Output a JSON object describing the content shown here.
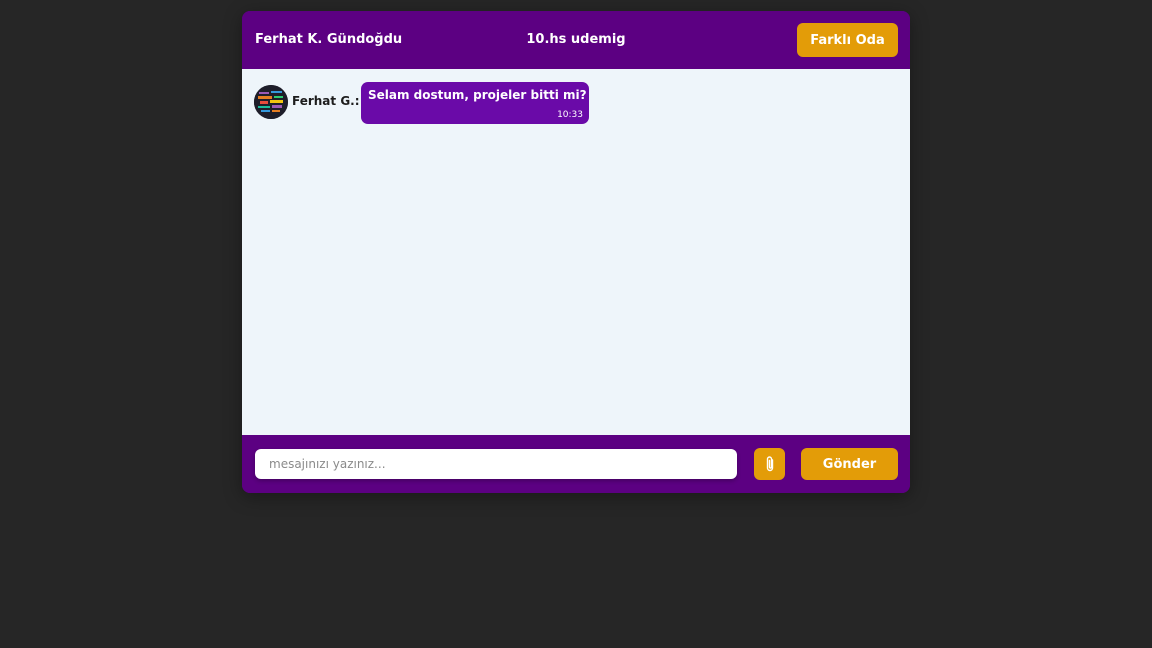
{
  "header": {
    "user_name": "Ferhat K. Gündoğdu",
    "room_name": "10.hs udemig",
    "change_room_label": "Farklı Oda"
  },
  "messages": [
    {
      "sender": "Ferhat G.:",
      "avatar_icon": "avatar-word-cloud",
      "text": "Selam dostum, projeler bitti mi?",
      "time": "10:33"
    }
  ],
  "composer": {
    "placeholder": "mesajınızı yazınız...",
    "value": "",
    "attach_icon": "paperclip-icon",
    "send_label": "Gönder"
  },
  "colors": {
    "header_bg": "#5c0082",
    "bubble_bg": "#6a0aa8",
    "accent": "#e39c08",
    "messages_bg": "#eef5fa",
    "page_bg": "#262626"
  }
}
